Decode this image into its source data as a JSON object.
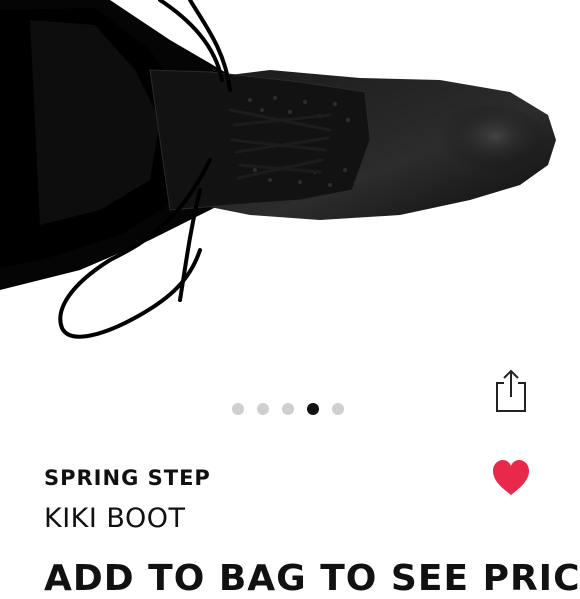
{
  "product": {
    "brand": "SPRING STEP",
    "name": "KIKI BOOT",
    "price_cta": "ADD TO BAG TO SEE PRICE",
    "image_alt": "Black lace-up leather boot"
  },
  "carousel": {
    "count": 5,
    "active_index": 3
  },
  "icons": {
    "share": "share-icon",
    "favorite": "heart-icon"
  },
  "colors": {
    "favorite": "#e8294c",
    "dot_active": "#111111",
    "dot_inactive": "#cfcfcf"
  }
}
